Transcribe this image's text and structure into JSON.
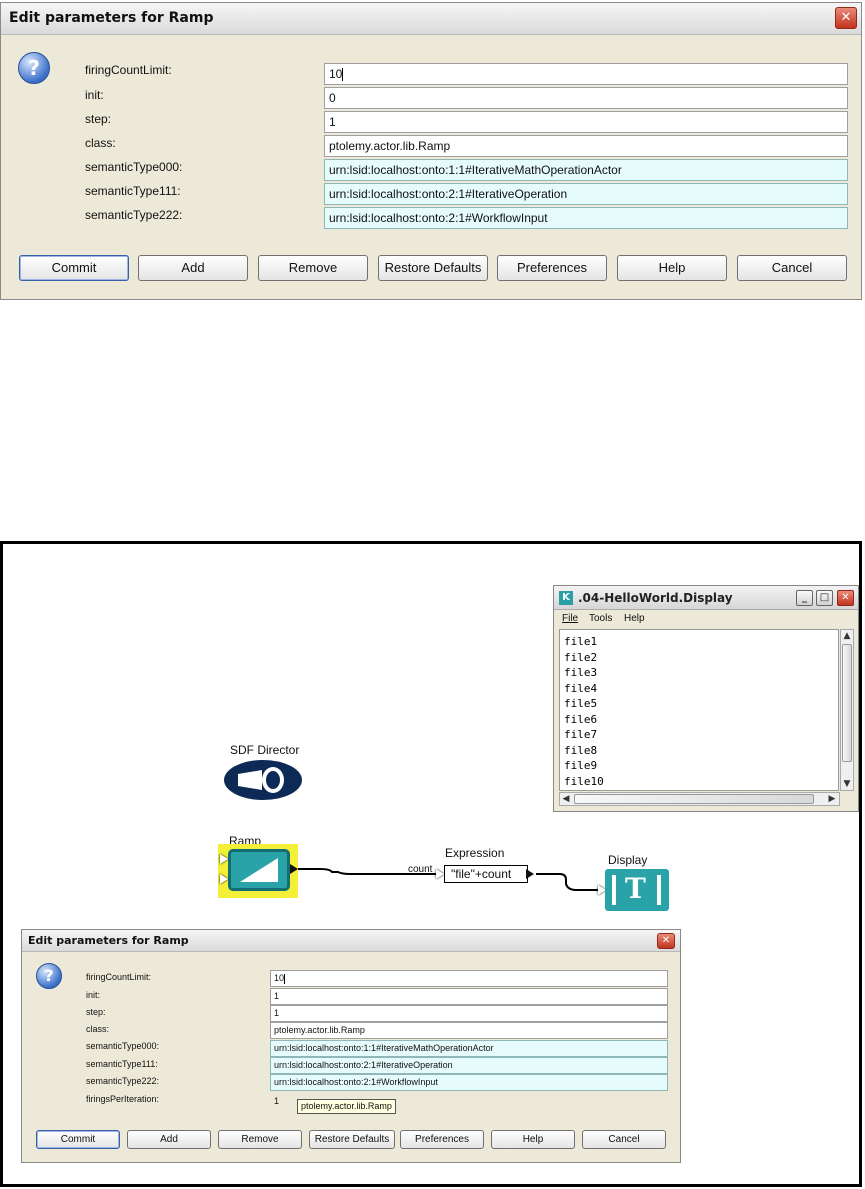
{
  "top_dialog": {
    "title": "Edit parameters for Ramp",
    "close_glyph": "✕",
    "help_glyph": "?",
    "params": [
      {
        "label": "firingCountLimit:",
        "value": "10",
        "semantic": false
      },
      {
        "label": "init:",
        "value": "0",
        "semantic": false
      },
      {
        "label": "step:",
        "value": "1",
        "semantic": false
      },
      {
        "label": "class:",
        "value": "ptolemy.actor.lib.Ramp",
        "semantic": false
      },
      {
        "label": "semanticType000:",
        "value": "urn:lsid:localhost:onto:1:1#IterativeMathOperationActor",
        "semantic": true
      },
      {
        "label": "semanticType111:",
        "value": "urn:lsid:localhost:onto:2:1#IterativeOperation",
        "semantic": true
      },
      {
        "label": "semanticType222:",
        "value": "urn:lsid:localhost:onto:2:1#WorkflowInput",
        "semantic": true
      }
    ],
    "buttons": {
      "commit": "Commit",
      "add": "Add",
      "remove": "Remove",
      "restore": "Restore Defaults",
      "preferences": "Preferences",
      "help": "Help",
      "cancel": "Cancel"
    }
  },
  "display_window": {
    "title": ".04-HelloWorld.Display",
    "icon_letter": "K",
    "menu": {
      "file": "File",
      "tools": "Tools",
      "help": "Help"
    },
    "lines": [
      "file1",
      "file2",
      "file3",
      "file4",
      "file5",
      "file6",
      "file7",
      "file8",
      "file9",
      "file10"
    ]
  },
  "workflow": {
    "director_label": "SDF Director",
    "ramp_label": "Ramp",
    "expression_label": "Expression",
    "expression_text": "\"file\"+count",
    "expression_port": "count",
    "display_label": "Display",
    "display_glyph": "T"
  },
  "bottom_dialog": {
    "title": "Edit parameters for Ramp",
    "close_glyph": "✕",
    "help_glyph": "?",
    "params": [
      {
        "label": "firingCountLimit:",
        "value": "10",
        "semantic": false
      },
      {
        "label": "init:",
        "value": "1",
        "semantic": false
      },
      {
        "label": "step:",
        "value": "1",
        "semantic": false
      },
      {
        "label": "class:",
        "value": "ptolemy.actor.lib.Ramp",
        "semantic": false
      },
      {
        "label": "semanticType000:",
        "value": "urn:lsid:localhost:onto:1:1#IterativeMathOperationActor",
        "semantic": true
      },
      {
        "label": "semanticType111:",
        "value": "urn:lsid:localhost:onto:2:1#IterativeOperation",
        "semantic": true
      },
      {
        "label": "semanticType222:",
        "value": "urn:lsid:localhost:onto:2:1#WorkflowInput",
        "semantic": true
      }
    ],
    "firings_label": "firingsPerIteration:",
    "firings_value": "1",
    "tooltip": "ptolemy.actor.lib.Ramp",
    "buttons": {
      "commit": "Commit",
      "add": "Add",
      "remove": "Remove",
      "restore": "Restore Defaults",
      "preferences": "Preferences",
      "help": "Help",
      "cancel": "Cancel"
    }
  }
}
